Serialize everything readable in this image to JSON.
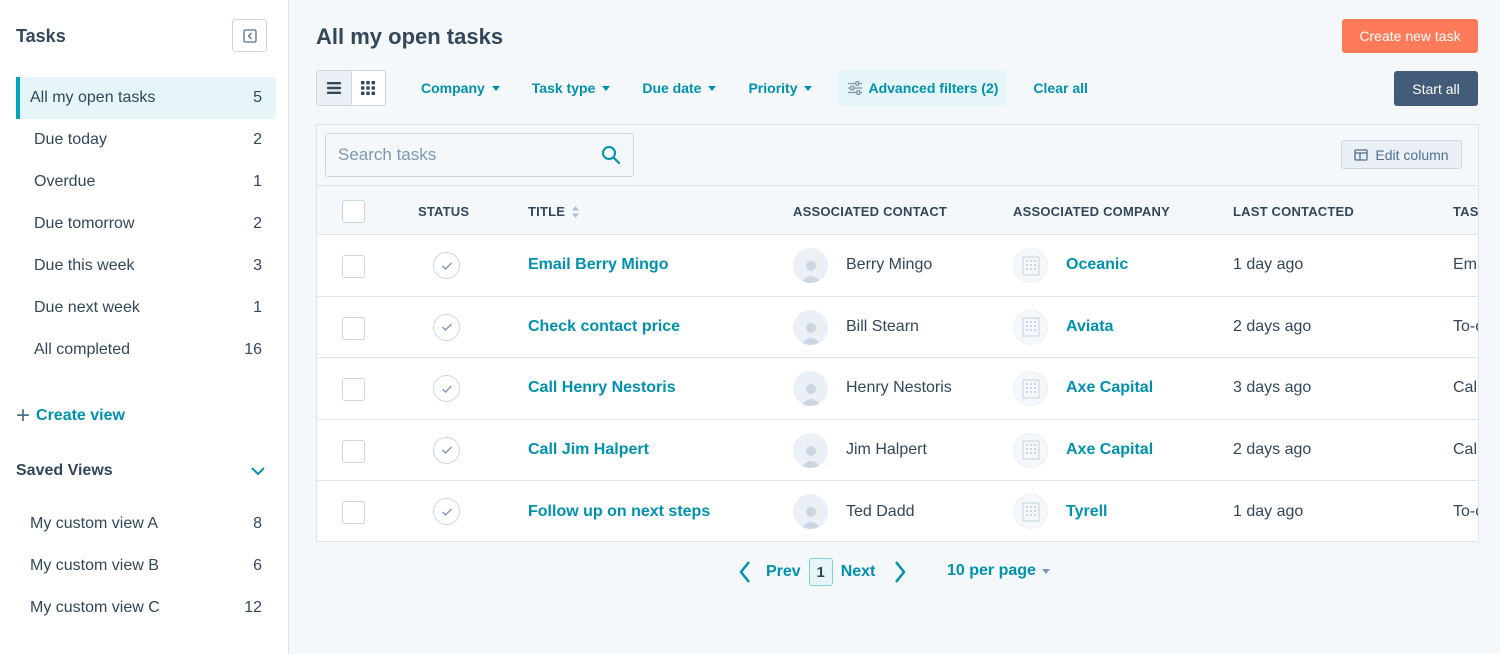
{
  "sidebar": {
    "title": "Tasks",
    "items": [
      {
        "label": "All my open tasks",
        "count": "5",
        "active": true
      },
      {
        "label": "Due today",
        "count": "2"
      },
      {
        "label": "Overdue",
        "count": "1"
      },
      {
        "label": "Due tomorrow",
        "count": "2"
      },
      {
        "label": "Due this week",
        "count": "3"
      },
      {
        "label": "Due next week",
        "count": "1"
      },
      {
        "label": "All completed",
        "count": "16"
      }
    ],
    "create_view": "Create view",
    "saved_views_title": "Saved Views",
    "saved_views": [
      {
        "label": "My custom view A",
        "count": "8"
      },
      {
        "label": "My custom view B",
        "count": "6"
      },
      {
        "label": "My custom view C",
        "count": "12"
      }
    ]
  },
  "header": {
    "title": "All my open tasks",
    "create_button": "Create new task",
    "start_button": "Start all"
  },
  "filters": {
    "company": "Company",
    "task_type": "Task type",
    "due_date": "Due date",
    "priority": "Priority",
    "advanced": "Advanced filters (2)",
    "clear": "Clear all"
  },
  "search": {
    "placeholder": "Search tasks"
  },
  "edit_column": "Edit column",
  "table": {
    "headers": {
      "status": "STATUS",
      "title": "TITLE",
      "contact": "ASSOCIATED CONTACT",
      "company": "ASSOCIATED COMPANY",
      "last_contacted": "LAST CONTACTED",
      "task_type": "TAS"
    },
    "rows": [
      {
        "title": "Email Berry Mingo",
        "contact": "Berry Mingo",
        "company": "Oceanic",
        "last_contacted": "1 day ago",
        "task_type": "Em"
      },
      {
        "title": "Check contact price",
        "contact": "Bill Stearn",
        "company": "Aviata",
        "last_contacted": "2 days ago",
        "task_type": "To-c"
      },
      {
        "title": "Call Henry Nestoris",
        "contact": "Henry Nestoris",
        "company": "Axe Capital",
        "last_contacted": "3 days ago",
        "task_type": "Cal"
      },
      {
        "title": "Call Jim Halpert",
        "contact": "Jim Halpert",
        "company": "Axe Capital",
        "last_contacted": "2 days ago",
        "task_type": "Cal"
      },
      {
        "title": "Follow up on next steps",
        "contact": "Ted Dadd",
        "company": "Tyrell",
        "last_contacted": "1 day ago",
        "task_type": "To-c"
      }
    ]
  },
  "pagination": {
    "prev": "Prev",
    "page": "1",
    "next": "Next",
    "per_page": "10 per page"
  },
  "colors": {
    "accent": "#0091ae",
    "primary_button": "#ff7a59",
    "secondary_button": "#425b76",
    "active_nav": "#e5f5f8"
  },
  "icons": {
    "collapse": "collapse-sidebar-icon",
    "list_view": "list-view-icon",
    "grid_view": "grid-view-icon",
    "search": "search-icon",
    "edit_column": "table-columns-icon",
    "filter": "sliders-icon",
    "sort": "sort-icon",
    "status": "check-circle-icon",
    "avatar": "person-avatar-icon",
    "company": "building-icon",
    "chevron": "chevron-down-icon"
  }
}
